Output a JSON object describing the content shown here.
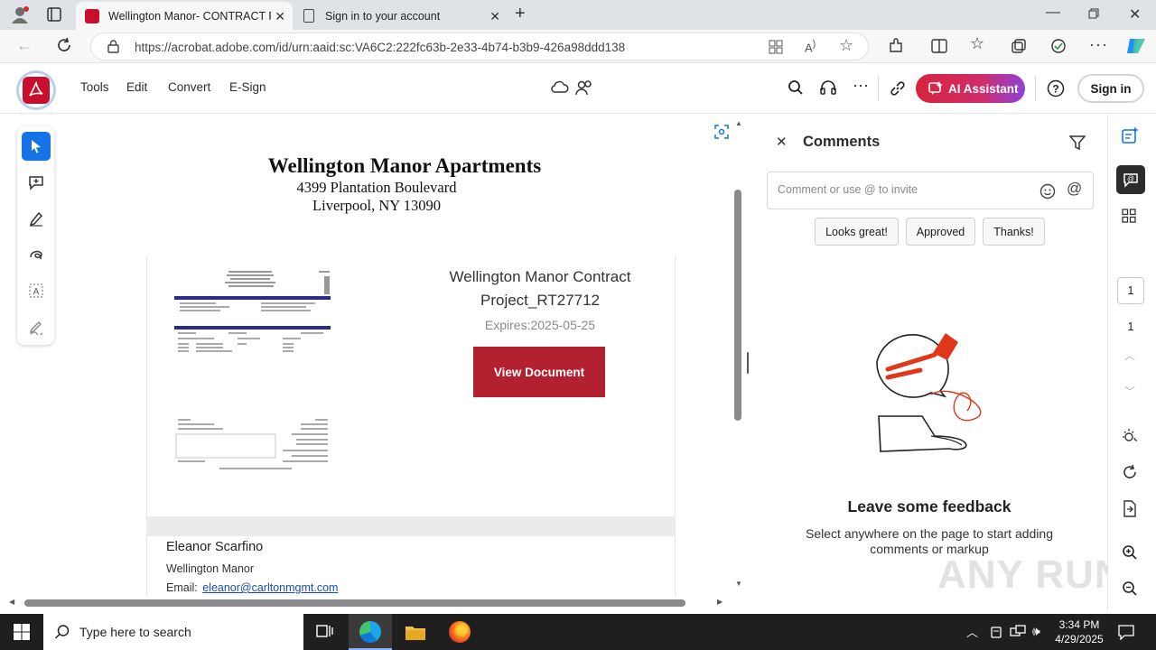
{
  "browser": {
    "tabs": [
      {
        "title": "Wellington Manor- CONTRACT F",
        "active": true,
        "icon": "acrobat-icon"
      },
      {
        "title": "Sign in to your account",
        "active": false,
        "icon": "page-icon"
      }
    ],
    "url": "https://acrobat.adobe.com/id/urn:aaid:sc:VA6C2:222fc63b-2e33-4b74-b3b9-426a98ddd138"
  },
  "acrobat": {
    "menu": [
      "Tools",
      "Edit",
      "Convert",
      "E-Sign"
    ],
    "ai_assistant_label": "AI Assistant",
    "sign_in_label": "Sign in"
  },
  "document": {
    "heading": "Wellington Manor Apartments",
    "address_line1": "4399 Plantation Boulevard",
    "address_line2": "Liverpool, NY 13090",
    "contract_title_line1": "Wellington Manor Contract",
    "contract_title_line2": "Project_RT27712",
    "expires": "Expires:2025-05-25",
    "view_button": "View Document",
    "contact_name": "Eleanor Scarfino",
    "contact_company": "Wellington Manor",
    "contact_email_label": "Email:",
    "contact_email": "eleanor@carltonmgmt.com"
  },
  "comments": {
    "title": "Comments",
    "input_placeholder": "Comment or use @ to invite",
    "quick_replies": [
      "Looks great!",
      "Approved",
      "Thanks!"
    ],
    "empty_title": "Leave some feedback",
    "empty_text": "Select anywhere on the page to start adding comments or markup"
  },
  "rail": {
    "page_current": "1",
    "page_total": "1"
  },
  "taskbar": {
    "search_placeholder": "Type here to search",
    "time": "3:34 PM",
    "date": "4/29/2025"
  },
  "watermark": "ANY RUN",
  "colors": {
    "acrobat_red": "#c8102e",
    "view_button": "#b3202f",
    "link": "#1a4db3",
    "selected_tool": "#1473e6"
  }
}
